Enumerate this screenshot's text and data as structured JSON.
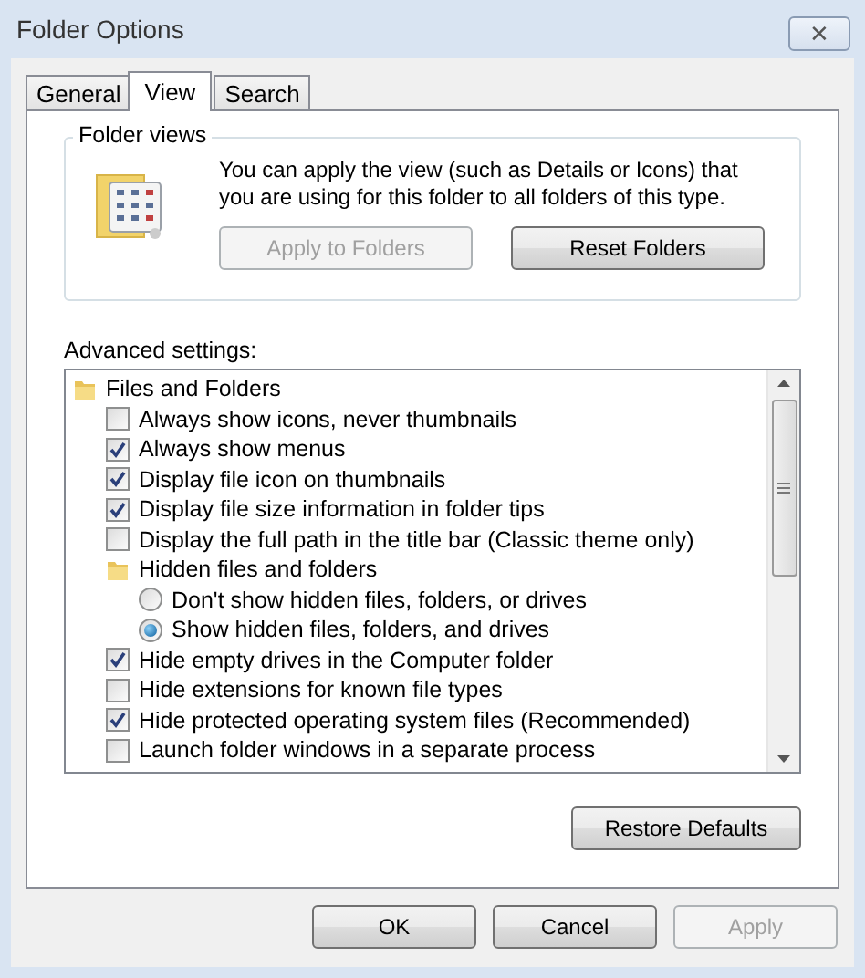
{
  "window": {
    "title": "Folder Options",
    "close_glyph": "✕"
  },
  "tabs": [
    {
      "label": "General",
      "selected": false
    },
    {
      "label": "View",
      "selected": true
    },
    {
      "label": "Search",
      "selected": false
    }
  ],
  "folder_views": {
    "legend": "Folder views",
    "description": "You can apply the view (such as Details or Icons) that you are using for this folder to all folders of this type.",
    "buttons": [
      {
        "label": "Apply to Folders",
        "disabled": true
      },
      {
        "label": "Reset Folders",
        "disabled": false
      }
    ]
  },
  "advanced_settings": {
    "label": "Advanced settings:",
    "items": [
      {
        "kind": "folder",
        "label": "Files and Folders",
        "children": [
          {
            "kind": "checkbox",
            "label": "Always show icons, never thumbnails",
            "checked": false
          },
          {
            "kind": "checkbox",
            "label": "Always show menus",
            "checked": true
          },
          {
            "kind": "checkbox",
            "label": "Display file icon on thumbnails",
            "checked": true
          },
          {
            "kind": "checkbox",
            "label": "Display file size information in folder tips",
            "checked": true
          },
          {
            "kind": "checkbox",
            "label": "Display the full path in the title bar (Classic theme only)",
            "checked": false
          },
          {
            "kind": "folder",
            "label": "Hidden files and folders",
            "children": [
              {
                "kind": "radio",
                "label": "Don't show hidden files, folders, or drives",
                "selected": false
              },
              {
                "kind": "radio",
                "label": "Show hidden files, folders, and drives",
                "selected": true
              }
            ]
          },
          {
            "kind": "checkbox",
            "label": "Hide empty drives in the Computer folder",
            "checked": true
          },
          {
            "kind": "checkbox",
            "label": "Hide extensions for known file types",
            "checked": false
          },
          {
            "kind": "checkbox",
            "label": "Hide protected operating system files (Recommended)",
            "checked": true
          },
          {
            "kind": "checkbox",
            "label": "Launch folder windows in a separate process",
            "checked": false
          }
        ]
      }
    ],
    "restore_button": {
      "label": "Restore Defaults",
      "disabled": false
    }
  },
  "buttons": [
    {
      "label": "OK",
      "disabled": false
    },
    {
      "label": "Cancel",
      "disabled": false
    },
    {
      "label": "Apply",
      "disabled": true
    }
  ]
}
